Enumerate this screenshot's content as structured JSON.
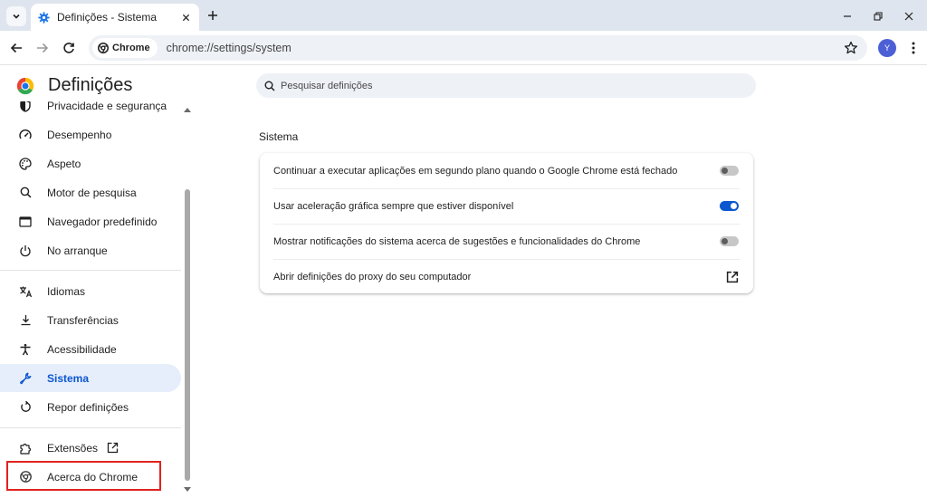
{
  "browser": {
    "tab_title": "Definições - Sistema",
    "chip_label": "Chrome",
    "url": "chrome://settings/system",
    "avatar_initial": "Y"
  },
  "settings": {
    "title": "Definições",
    "search_placeholder": "Pesquisar definições",
    "nav_items": [
      {
        "label": "Privacidade e segurança",
        "icon": "shield-icon"
      },
      {
        "label": "Desempenho",
        "icon": "speedometer-icon"
      },
      {
        "label": "Aspeto",
        "icon": "palette-icon"
      },
      {
        "label": "Motor de pesquisa",
        "icon": "search-icon"
      },
      {
        "label": "Navegador predefinido",
        "icon": "browser-window-icon"
      },
      {
        "label": "No arranque",
        "icon": "power-icon"
      },
      {
        "label": "Idiomas",
        "icon": "translate-icon"
      },
      {
        "label": "Transferências",
        "icon": "download-icon"
      },
      {
        "label": "Acessibilidade",
        "icon": "accessibility-icon"
      },
      {
        "label": "Sistema",
        "icon": "wrench-icon",
        "active": true
      },
      {
        "label": "Repor definições",
        "icon": "reset-icon"
      },
      {
        "label": "Extensões",
        "icon": "puzzle-icon"
      },
      {
        "label": "Acerca do Chrome",
        "icon": "chrome-icon"
      }
    ],
    "section": {
      "title": "Sistema",
      "rows": [
        {
          "label": "Continuar a executar aplicações em segundo plano quando o Google Chrome está fechado",
          "control": "toggle",
          "enabled": false
        },
        {
          "label": "Usar aceleração gráfica sempre que estiver disponível",
          "control": "toggle",
          "enabled": true
        },
        {
          "label": "Mostrar notificações do sistema acerca de sugestões e funcionalidades do Chrome",
          "control": "toggle",
          "enabled": false
        },
        {
          "label": "Abrir definições do proxy do seu computador",
          "control": "external-link"
        }
      ]
    }
  },
  "colors": {
    "accent": "#0b57d0",
    "highlight_box": "#e0231e",
    "active_nav_bg": "#e6eefb"
  }
}
